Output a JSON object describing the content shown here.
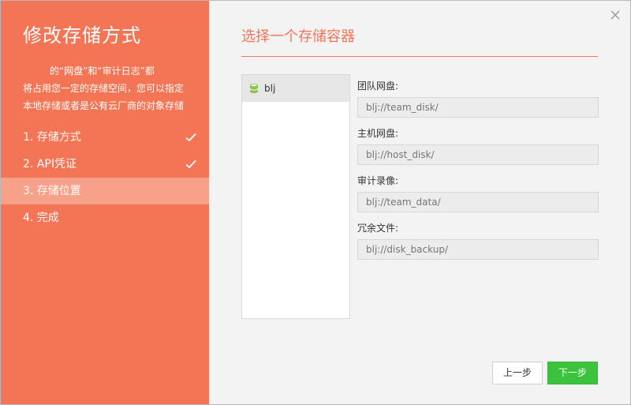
{
  "left_panel": {
    "title": "修改存储方式",
    "desc_line1": "的“网盘”和“审计日志”都",
    "desc_line2": "将占用您一定的存储空间，您可以指定",
    "desc_line3": "本地存储或者是公有云厂商的对象存储",
    "steps": [
      {
        "label": "1. 存储方式",
        "done": true
      },
      {
        "label": "2. API凭证",
        "done": true
      },
      {
        "label": "3. 存储位置",
        "active": true
      },
      {
        "label": "4. 完成"
      }
    ]
  },
  "right_panel": {
    "title": "选择一个存储容器",
    "containers": [
      {
        "name": "blj",
        "icon": "database-icon",
        "selected": true
      }
    ],
    "fields": [
      {
        "label": "团队网盘:",
        "placeholder": "blj://team_disk/"
      },
      {
        "label": "主机网盘:",
        "placeholder": "blj://host_disk/"
      },
      {
        "label": "审计录像:",
        "placeholder": "blj://team_data/"
      },
      {
        "label": "冗余文件:",
        "placeholder": "blj://disk_backup/"
      }
    ],
    "prev_label": "上一步",
    "next_label": "下一步"
  },
  "colors": {
    "accent": "#f47556",
    "accent_light": "#f8a18a",
    "primary_button": "#3cc23c"
  }
}
